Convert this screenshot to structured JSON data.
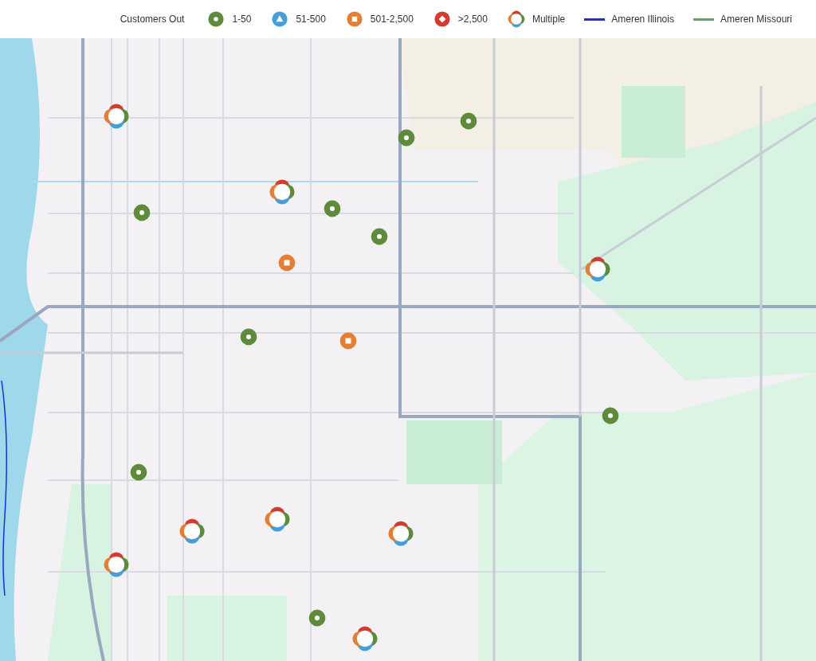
{
  "legend": {
    "title": "Customers Out",
    "items": [
      {
        "kind": "dot",
        "label": "1-50",
        "color": "#5e8a3c"
      },
      {
        "kind": "triangle",
        "label": "51-500",
        "color": "#459fd8"
      },
      {
        "kind": "square",
        "label": "501-2,500",
        "color": "#e57d33"
      },
      {
        "kind": "diamond",
        "label": ">2,500",
        "color": "#d63a2f"
      },
      {
        "kind": "multiple",
        "label": "Multiple"
      },
      {
        "kind": "line",
        "label": "Ameren Illinois",
        "color": "#1a2fe0"
      },
      {
        "kind": "line",
        "label": "Ameren Missouri",
        "color": "#5aa85a"
      }
    ]
  },
  "markers": [
    {
      "kind": "multiple"
    },
    {
      "kind": "dot"
    },
    {
      "kind": "dot"
    },
    {
      "kind": "multiple"
    },
    {
      "kind": "dot"
    },
    {
      "kind": "dot"
    },
    {
      "kind": "dot"
    },
    {
      "kind": "square"
    },
    {
      "kind": "multiple"
    },
    {
      "kind": "dot"
    },
    {
      "kind": "square"
    },
    {
      "kind": "dot"
    },
    {
      "kind": "dot"
    },
    {
      "kind": "multiple"
    },
    {
      "kind": "multiple"
    },
    {
      "kind": "multiple"
    },
    {
      "kind": "multiple"
    },
    {
      "kind": "dot"
    },
    {
      "kind": "multiple"
    }
  ]
}
